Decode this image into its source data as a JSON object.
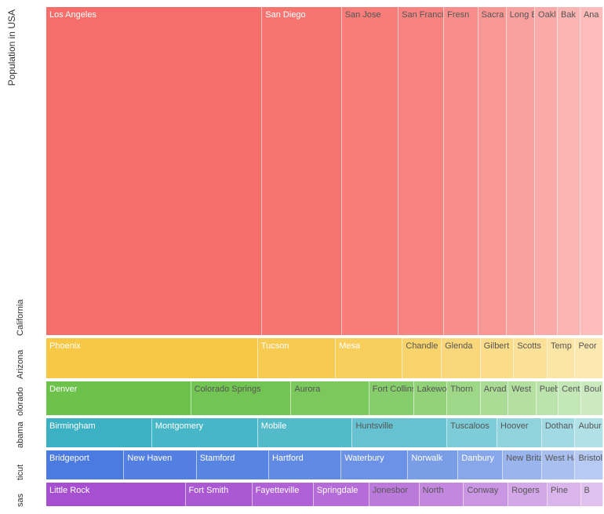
{
  "chart_data": {
    "type": "area",
    "title": "",
    "ylabel": "Population in USA",
    "rows": [
      {
        "id": "california",
        "name": "California",
        "labelCrop": "California",
        "baseColor": "#f66e6a",
        "height": 62,
        "cities": [
          {
            "name": "Los Angeles",
            "value": 38,
            "dark": false,
            "shade": 1.0
          },
          {
            "name": "San Diego",
            "value": 14,
            "dark": false,
            "shade": 0.95
          },
          {
            "name": "San Jose",
            "value": 10,
            "dark": true,
            "shade": 0.9
          },
          {
            "name": "San Francisco",
            "value": 8,
            "dark": true,
            "shade": 0.85
          },
          {
            "name": "Fresno",
            "value": 6,
            "dark": true,
            "shade": 0.78,
            "crop": "Fresn"
          },
          {
            "name": "Sacramento",
            "value": 5,
            "dark": true,
            "shade": 0.72,
            "crop": "Sacra"
          },
          {
            "name": "Long Beach",
            "value": 5,
            "dark": true,
            "shade": 0.65
          },
          {
            "name": "Oakland",
            "value": 4,
            "dark": true,
            "shade": 0.58,
            "crop": "Oakl"
          },
          {
            "name": "Bakersfield",
            "value": 4,
            "dark": true,
            "shade": 0.52,
            "crop": "Bak"
          },
          {
            "name": "Anaheim",
            "value": 4,
            "dark": true,
            "shade": 0.46,
            "crop": "Ana"
          }
        ]
      },
      {
        "id": "arizona",
        "name": "Arizona",
        "labelCrop": "Arizona",
        "baseColor": "#f7c846",
        "height": 8,
        "cities": [
          {
            "name": "Phoenix",
            "value": 38,
            "dark": false,
            "shade": 1.0
          },
          {
            "name": "Tucson",
            "value": 14,
            "dark": false,
            "shade": 0.94
          },
          {
            "name": "Mesa",
            "value": 12,
            "dark": false,
            "shade": 0.88
          },
          {
            "name": "Chandler",
            "value": 7,
            "dark": true,
            "shade": 0.8,
            "crop": "Chandle"
          },
          {
            "name": "Glendale",
            "value": 7,
            "dark": true,
            "shade": 0.72,
            "crop": "Glenda"
          },
          {
            "name": "Gilbert",
            "value": 6,
            "dark": true,
            "shade": 0.64
          },
          {
            "name": "Scottsdale",
            "value": 6,
            "dark": true,
            "shade": 0.56,
            "crop": "Scotts"
          },
          {
            "name": "Tempe",
            "value": 5,
            "dark": true,
            "shade": 0.48,
            "crop": "Temp"
          },
          {
            "name": "Peoria",
            "value": 5,
            "dark": true,
            "shade": 0.42,
            "crop": "Peor"
          }
        ]
      },
      {
        "id": "colorado",
        "name": "Colorado",
        "labelCrop": "olorado",
        "baseColor": "#6cc24a",
        "height": 7,
        "cities": [
          {
            "name": "Denver",
            "value": 26,
            "dark": false,
            "shade": 1.0
          },
          {
            "name": "Colorado Springs",
            "value": 18,
            "dark": true,
            "shade": 0.95
          },
          {
            "name": "Aurora",
            "value": 14,
            "dark": true,
            "shade": 0.9
          },
          {
            "name": "Fort Collins",
            "value": 8,
            "dark": true,
            "shade": 0.82
          },
          {
            "name": "Lakewood",
            "value": 6,
            "dark": true,
            "shade": 0.74,
            "crop": "Lakewo"
          },
          {
            "name": "Thornton",
            "value": 6,
            "dark": true,
            "shade": 0.66,
            "crop": "Thorn"
          },
          {
            "name": "Arvada",
            "value": 5,
            "dark": true,
            "shade": 0.58,
            "crop": "Arvad"
          },
          {
            "name": "Westminster",
            "value": 5,
            "dark": true,
            "shade": 0.52,
            "crop": "West"
          },
          {
            "name": "Pueblo",
            "value": 4,
            "dark": true,
            "shade": 0.46,
            "crop": "Puebl"
          },
          {
            "name": "Centennial",
            "value": 4,
            "dark": true,
            "shade": 0.4,
            "crop": "Cent"
          },
          {
            "name": "Boulder",
            "value": 4,
            "dark": true,
            "shade": 0.35,
            "crop": "Boul"
          }
        ]
      },
      {
        "id": "alabama",
        "name": "Alabama",
        "labelCrop": "abama",
        "baseColor": "#3bb1c3",
        "height": 6,
        "cities": [
          {
            "name": "Birmingham",
            "value": 19,
            "dark": false,
            "shade": 1.0
          },
          {
            "name": "Montgomery",
            "value": 19,
            "dark": false,
            "shade": 0.94
          },
          {
            "name": "Mobile",
            "value": 17,
            "dark": false,
            "shade": 0.88
          },
          {
            "name": "Huntsville",
            "value": 17,
            "dark": true,
            "shade": 0.78
          },
          {
            "name": "Tuscaloosa",
            "value": 9,
            "dark": true,
            "shade": 0.66,
            "crop": "Tuscaloos"
          },
          {
            "name": "Hoover",
            "value": 8,
            "dark": true,
            "shade": 0.56
          },
          {
            "name": "Dothan",
            "value": 6,
            "dark": true,
            "shade": 0.48
          },
          {
            "name": "Auburn",
            "value": 5,
            "dark": true,
            "shade": 0.4,
            "crop": "Aubur"
          }
        ]
      },
      {
        "id": "connecticut",
        "name": "Connecticut",
        "labelCrop": "ticut",
        "baseColor": "#4b7ae0",
        "height": 6,
        "cities": [
          {
            "name": "Bridgeport",
            "value": 14,
            "dark": false,
            "shade": 1.0
          },
          {
            "name": "New Haven",
            "value": 13,
            "dark": false,
            "shade": 0.96
          },
          {
            "name": "Stamford",
            "value": 13,
            "dark": false,
            "shade": 0.92
          },
          {
            "name": "Hartford",
            "value": 13,
            "dark": false,
            "shade": 0.88
          },
          {
            "name": "Waterbury",
            "value": 12,
            "dark": false,
            "shade": 0.82
          },
          {
            "name": "Norwalk",
            "value": 9,
            "dark": false,
            "shade": 0.74
          },
          {
            "name": "Danbury",
            "value": 8,
            "dark": false,
            "shade": 0.66
          },
          {
            "name": "New Britain",
            "value": 7,
            "dark": true,
            "shade": 0.56
          },
          {
            "name": "West Hartford",
            "value": 6,
            "dark": true,
            "shade": 0.48,
            "crop": "West Hartfor"
          },
          {
            "name": "Bristol",
            "value": 5,
            "dark": true,
            "shade": 0.4,
            "crop": "Bristol"
          }
        ]
      },
      {
        "id": "arkansas",
        "name": "Arkansas",
        "labelCrop": "sas",
        "baseColor": "#a74fd1",
        "height": 5,
        "cities": [
          {
            "name": "Little Rock",
            "value": 25,
            "dark": false,
            "shade": 1.0
          },
          {
            "name": "Fort Smith",
            "value": 12,
            "dark": false,
            "shade": 0.95
          },
          {
            "name": "Fayetteville",
            "value": 11,
            "dark": false,
            "shade": 0.9
          },
          {
            "name": "Springdale",
            "value": 10,
            "dark": false,
            "shade": 0.84
          },
          {
            "name": "Jonesboro",
            "value": 9,
            "dark": true,
            "shade": 0.76,
            "crop": "Jonesbor"
          },
          {
            "name": "North Little Rock",
            "value": 8,
            "dark": true,
            "shade": 0.68,
            "crop": "North"
          },
          {
            "name": "Conway",
            "value": 8,
            "dark": true,
            "shade": 0.6
          },
          {
            "name": "Rogers",
            "value": 7,
            "dark": true,
            "shade": 0.5
          },
          {
            "name": "Pine Bluff",
            "value": 6,
            "dark": true,
            "shade": 0.42,
            "crop": "Pine"
          },
          {
            "name": "Bentonville",
            "value": 4,
            "dark": true,
            "shade": 0.36,
            "crop": "B"
          }
        ]
      }
    ]
  }
}
